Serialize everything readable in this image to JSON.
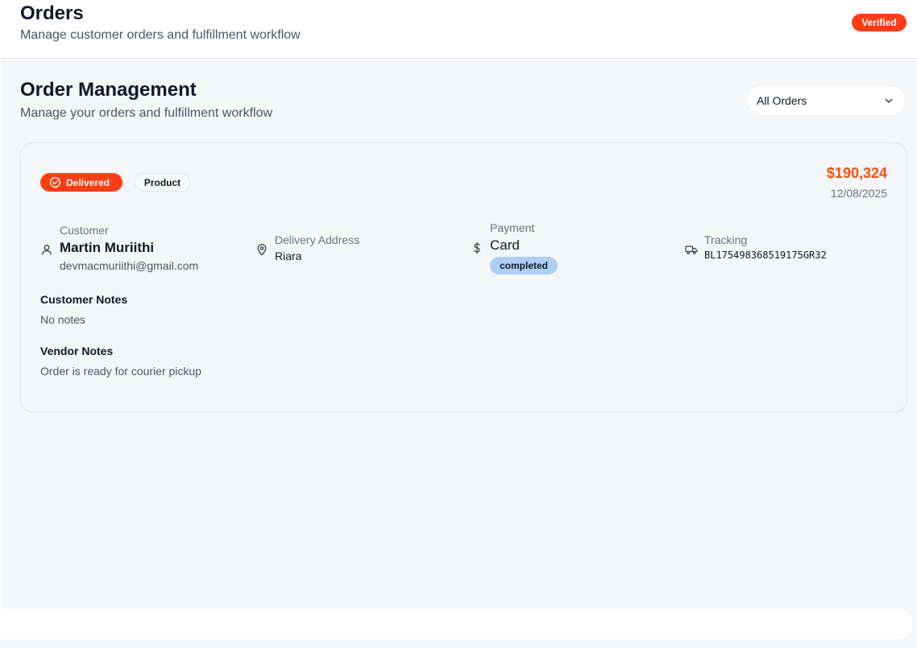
{
  "header": {
    "title": "Orders",
    "subtitle": "Manage customer orders and fulfillment workflow",
    "status_badge": "Verified"
  },
  "main": {
    "title": "Order Management",
    "subtitle": "Manage your orders and fulfillment workflow",
    "filter": {
      "selected": "All Orders"
    }
  },
  "order": {
    "status": "Delivered",
    "type": "Product",
    "amount": "$190,324",
    "date": "12/08/2025",
    "customer": {
      "label": "Customer",
      "name": "Martin Muriithi",
      "email": "devmacmuriithi@gmail.com"
    },
    "delivery": {
      "label": "Delivery Address",
      "address": "Riara"
    },
    "payment": {
      "label": "Payment",
      "method": "Card",
      "status": "completed"
    },
    "tracking": {
      "label": "Tracking",
      "number": "BL175498368519175GR32"
    },
    "customer_notes": {
      "label": "Customer Notes",
      "text": "No notes"
    },
    "vendor_notes": {
      "label": "Vendor Notes",
      "text": "Order is ready for courier pickup"
    }
  },
  "colors": {
    "accent": "#ff3d14",
    "amount": "#ff4d12",
    "payment_badge": "#aecff5"
  }
}
